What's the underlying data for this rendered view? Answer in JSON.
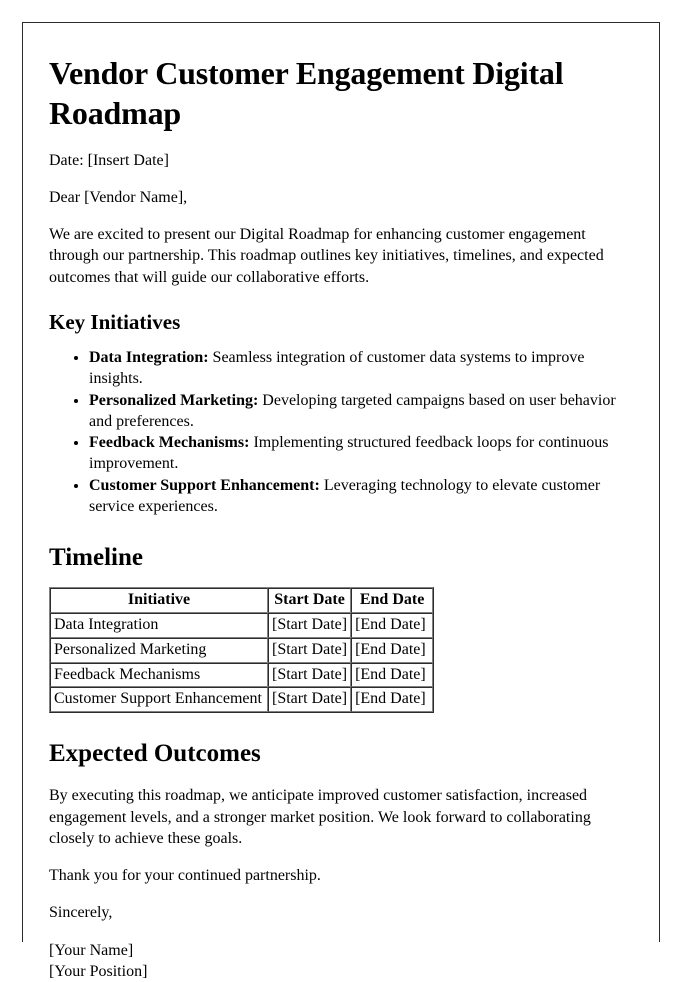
{
  "document": {
    "title": "Vendor Customer Engagement Digital Roadmap",
    "date_line": "Date: [Insert Date]",
    "salutation": "Dear [Vendor Name],",
    "intro_paragraph": "We are excited to present our Digital Roadmap for enhancing customer engagement through our partnership. This roadmap outlines key initiatives, timelines, and expected outcomes that will guide our collaborative efforts."
  },
  "key_initiatives": {
    "heading": "Key Initiatives",
    "items": [
      {
        "lead": "Data Integration:",
        "text": " Seamless integration of customer data systems to improve insights."
      },
      {
        "lead": "Personalized Marketing:",
        "text": " Developing targeted campaigns based on user behavior and preferences."
      },
      {
        "lead": "Feedback Mechanisms:",
        "text": " Implementing structured feedback loops for continuous improvement."
      },
      {
        "lead": "Customer Support Enhancement:",
        "text": " Leveraging technology to elevate customer service experiences."
      }
    ]
  },
  "timeline": {
    "heading": "Timeline",
    "columns": [
      "Initiative",
      "Start Date",
      "End Date"
    ],
    "rows": [
      [
        "Data Integration",
        "[Start Date]",
        "[End Date]"
      ],
      [
        "Personalized Marketing",
        "[Start Date]",
        "[End Date]"
      ],
      [
        "Feedback Mechanisms",
        "[Start Date]",
        "[End Date]"
      ],
      [
        "Customer Support Enhancement",
        "[Start Date]",
        "[End Date]"
      ]
    ]
  },
  "expected_outcomes": {
    "heading": "Expected Outcomes",
    "paragraph": "By executing this roadmap, we anticipate improved customer satisfaction, increased engagement levels, and a stronger market position. We look forward to collaborating closely to achieve these goals."
  },
  "closing": {
    "thanks": "Thank you for your continued partnership.",
    "sign_off": "Sincerely,",
    "name": "[Your Name]",
    "position": "[Your Position]"
  },
  "colors": {
    "text": "#000000",
    "page_border": "#2b2b2b",
    "table_border": "#808080",
    "background": "#ffffff"
  }
}
